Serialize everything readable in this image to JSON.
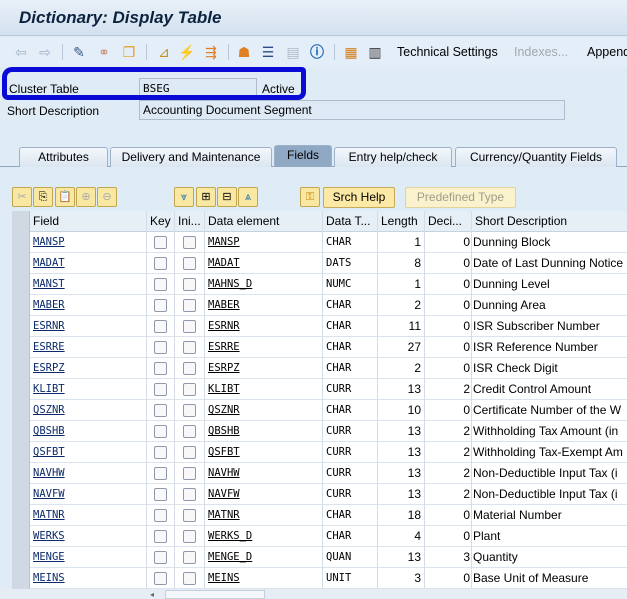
{
  "title": "Dictionary: Display Table",
  "toolbar": {
    "technical_settings": "Technical Settings",
    "indexes": "Indexes...",
    "append": "Append"
  },
  "header": {
    "type_label": "Cluster Table",
    "table_name": "BSEG",
    "status": "Active",
    "short_desc_label": "Short Description",
    "short_desc": "Accounting Document Segment"
  },
  "tabs": [
    "Attributes",
    "Delivery and Maintenance",
    "Fields",
    "Entry help/check",
    "Currency/Quantity Fields"
  ],
  "active_tab": "Fields",
  "buttons": {
    "srch_help": "Srch Help",
    "predefined_type": "Predefined Type"
  },
  "columns": [
    "Field",
    "Key",
    "Ini...",
    "Data element",
    "Data T...",
    "Length",
    "Deci...",
    "Short Description"
  ],
  "rows": [
    {
      "field": "MANSP",
      "de": "MANSP",
      "type": "CHAR",
      "len": "1",
      "dec": "0",
      "desc": "Dunning Block"
    },
    {
      "field": "MADAT",
      "de": "MADAT",
      "type": "DATS",
      "len": "8",
      "dec": "0",
      "desc": "Date of Last Dunning Notice"
    },
    {
      "field": "MANST",
      "de": "MAHNS_D",
      "type": "NUMC",
      "len": "1",
      "dec": "0",
      "desc": "Dunning Level"
    },
    {
      "field": "MABER",
      "de": "MABER",
      "type": "CHAR",
      "len": "2",
      "dec": "0",
      "desc": "Dunning Area"
    },
    {
      "field": "ESRNR",
      "de": "ESRNR",
      "type": "CHAR",
      "len": "11",
      "dec": "0",
      "desc": "ISR Subscriber Number"
    },
    {
      "field": "ESRRE",
      "de": "ESRRE",
      "type": "CHAR",
      "len": "27",
      "dec": "0",
      "desc": "ISR Reference Number"
    },
    {
      "field": "ESRPZ",
      "de": "ESRPZ",
      "type": "CHAR",
      "len": "2",
      "dec": "0",
      "desc": "ISR Check Digit"
    },
    {
      "field": "KLIBT",
      "de": "KLIBT",
      "type": "CURR",
      "len": "13",
      "dec": "2",
      "desc": "Credit Control Amount"
    },
    {
      "field": "QSZNR",
      "de": "QSZNR",
      "type": "CHAR",
      "len": "10",
      "dec": "0",
      "desc": "Certificate Number of the W"
    },
    {
      "field": "QBSHB",
      "de": "QBSHB",
      "type": "CURR",
      "len": "13",
      "dec": "2",
      "desc": "Withholding Tax Amount (in"
    },
    {
      "field": "QSFBT",
      "de": "QSFBT",
      "type": "CURR",
      "len": "13",
      "dec": "2",
      "desc": "Withholding Tax-Exempt Am"
    },
    {
      "field": "NAVHW",
      "de": "NAVHW",
      "type": "CURR",
      "len": "13",
      "dec": "2",
      "desc": "Non-Deductible Input Tax (i"
    },
    {
      "field": "NAVFW",
      "de": "NAVFW",
      "type": "CURR",
      "len": "13",
      "dec": "2",
      "desc": "Non-Deductible Input Tax (i"
    },
    {
      "field": "MATNR",
      "de": "MATNR",
      "type": "CHAR",
      "len": "18",
      "dec": "0",
      "desc": "Material Number"
    },
    {
      "field": "WERKS",
      "de": "WERKS_D",
      "type": "CHAR",
      "len": "4",
      "dec": "0",
      "desc": "Plant"
    },
    {
      "field": "MENGE",
      "de": "MENGE_D",
      "type": "QUAN",
      "len": "13",
      "dec": "3",
      "desc": "Quantity"
    },
    {
      "field": "MEINS",
      "de": "MEINS",
      "type": "UNIT",
      "len": "3",
      "dec": "0",
      "desc": "Base Unit of Measure"
    }
  ]
}
